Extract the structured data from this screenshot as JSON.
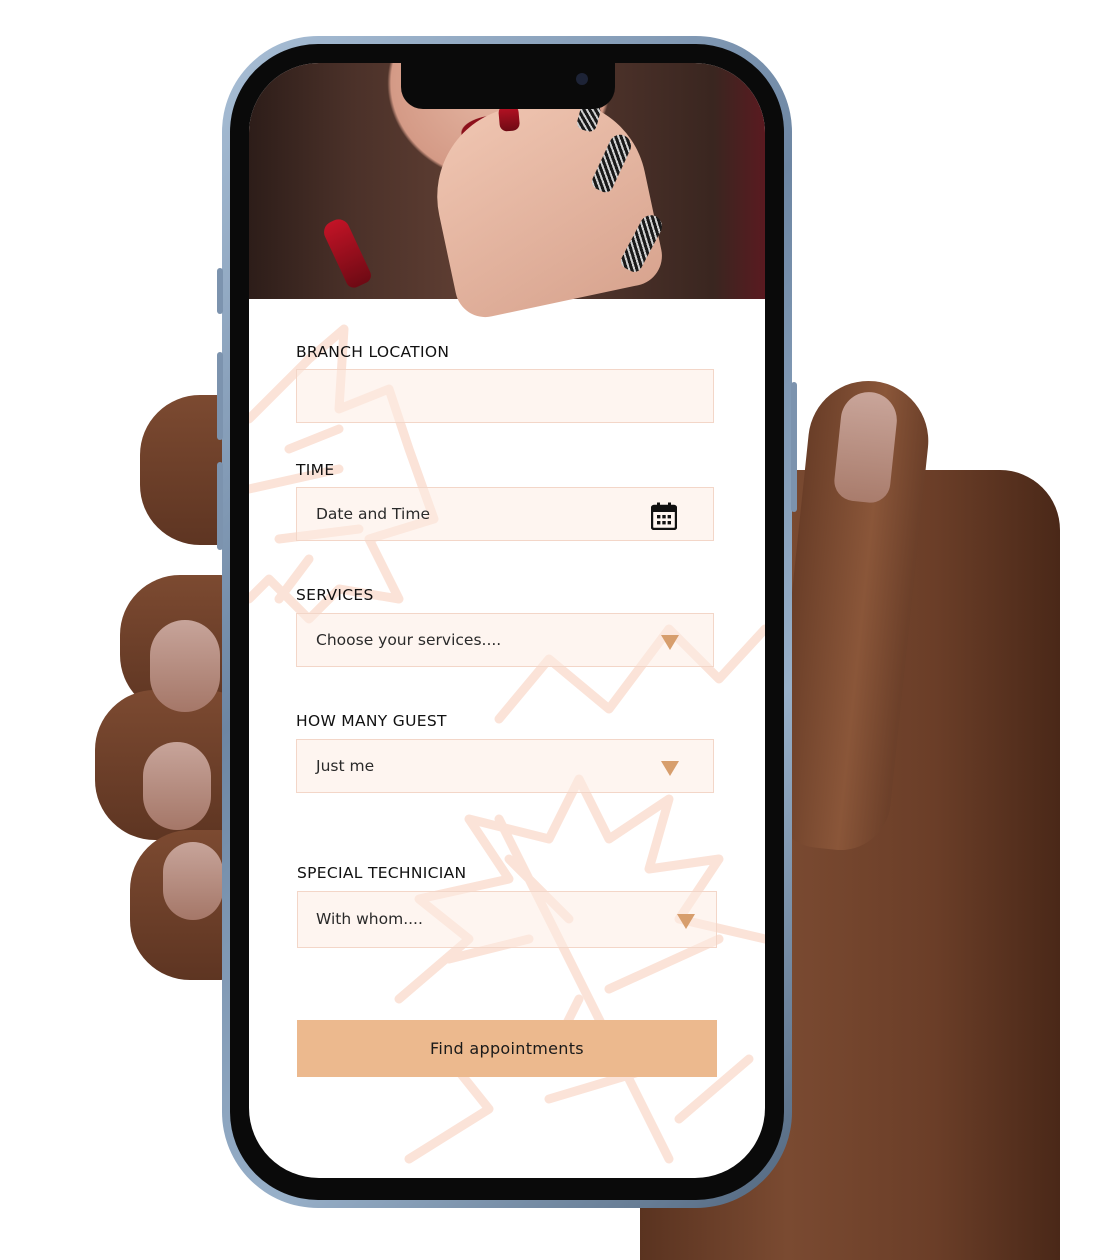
{
  "form": {
    "branch": {
      "label": "BRANCH LOCATION",
      "value": ""
    },
    "time": {
      "label": "TIME",
      "placeholder": "Date and Time",
      "icon": "calendar-icon"
    },
    "services": {
      "label": "SERVICES",
      "placeholder": "Choose your services....",
      "icon": "caret-down-icon"
    },
    "guests": {
      "label": "HOW MANY GUEST",
      "value": "Just me",
      "icon": "caret-down-icon"
    },
    "technician": {
      "label": "SPECIAL TECHNICIAN",
      "placeholder": "With whom....",
      "icon": "caret-down-icon"
    },
    "submit_label": "Find  appointments"
  },
  "colors": {
    "accent": "#ecb98e",
    "caret": "#d79e6d",
    "field_bg": "#fdece4",
    "field_border": "#f3d6c8",
    "leaf_outline": "#fbe3d8"
  }
}
